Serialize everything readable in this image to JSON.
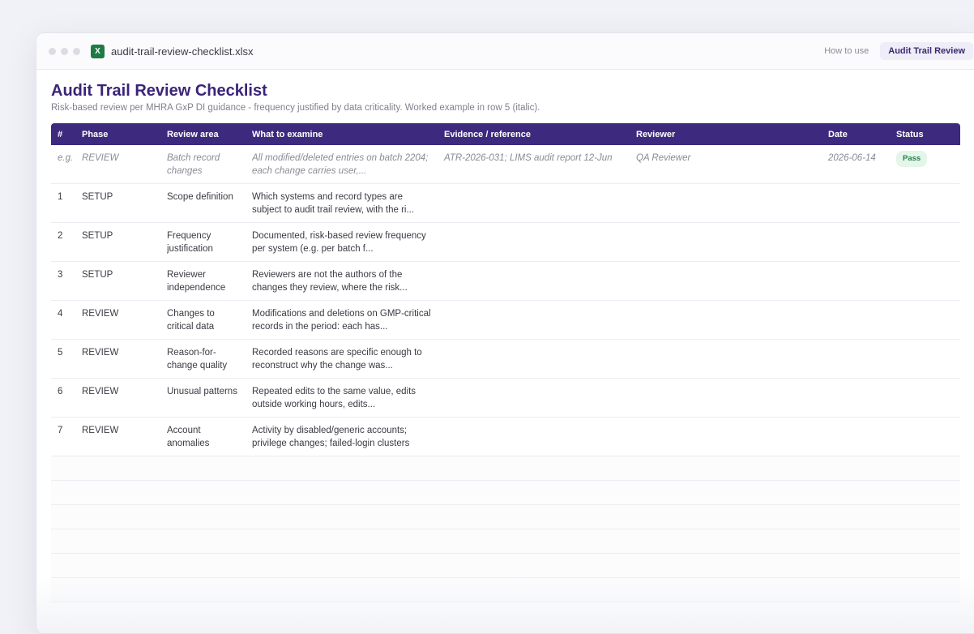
{
  "window": {
    "filename": "audit-trail-review-checklist.xlsx",
    "file_icon_letter": "X",
    "how_to_use": "How to use",
    "active_tab": "Audit Trail Review"
  },
  "sheet": {
    "title": "Audit Trail Review Checklist",
    "subtitle": "Risk-based review per MHRA GxP DI guidance - frequency justified by data criticality. Worked example in row 5 (italic)."
  },
  "table": {
    "headers": [
      "#",
      "Phase",
      "Review area",
      "What to examine",
      "Evidence / reference",
      "Reviewer",
      "Date",
      "Status"
    ],
    "example": {
      "num": "e.g.",
      "phase": "REVIEW",
      "area": "Batch record changes",
      "examine": "All modified/deleted entries on batch 2204; each change carries user,...",
      "evidence": "ATR-2026-031; LIMS audit report 12-Jun",
      "reviewer": "QA Reviewer",
      "date": "2026-06-14",
      "status": "Pass",
      "status_color": "#24804b"
    },
    "rows": [
      {
        "num": "1",
        "phase": "SETUP",
        "area": "Scope definition",
        "examine": "Which systems and record types are subject to audit trail review, with the ri..."
      },
      {
        "num": "2",
        "phase": "SETUP",
        "area": "Frequency justification",
        "examine": "Documented, risk-based review frequency per system (e.g. per batch f..."
      },
      {
        "num": "3",
        "phase": "SETUP",
        "area": "Reviewer independence",
        "examine": "Reviewers are not the authors of the changes they review, where the risk..."
      },
      {
        "num": "4",
        "phase": "REVIEW",
        "area": "Changes to critical data",
        "examine": "Modifications and deletions on GMP-critical records in the period: each has..."
      },
      {
        "num": "5",
        "phase": "REVIEW",
        "area": "Reason-for-change quality",
        "examine": "Recorded reasons are specific enough to reconstruct why the change was..."
      },
      {
        "num": "6",
        "phase": "REVIEW",
        "area": "Unusual patterns",
        "examine": "Repeated edits to the same value, edits outside working hours, edits..."
      },
      {
        "num": "7",
        "phase": "REVIEW",
        "area": "Account anomalies",
        "examine": "Activity by disabled/generic accounts; privilege changes; failed-login clusters"
      }
    ]
  },
  "colors": {
    "header_bg": "#3d2a7e",
    "title": "#3b2478",
    "pass_bg": "#e4f5ea"
  }
}
